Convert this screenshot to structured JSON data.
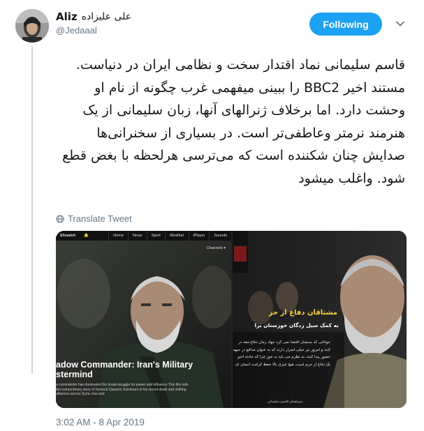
{
  "tweet": {
    "author_name": "Aliz",
    "author_name_fa": "علی علیزاده",
    "handle": "@Jedaaal",
    "follow_label": "Following",
    "text": "قاسم سلیمانی نماد اقتدار سخت و نظامی ایران در دنیاست. مستند اخیر BBC2 را ببینی میفهمی غرب چگونه از نام او وحشت دارد. اما برخلاف ژنرالهای آنها، زبان سلیمانی از یک هنرمند نرمتر وعاطفی‌تر است. در بسیاری از سخنرانی‌ها صدایش چنان شکننده است که می‌ترسی هرلحظه با بغض قطع شود. واغلب میشود",
    "translate_label": "Translate Tweet",
    "timestamp": "3:02 AM - 8 Apr 2019"
  },
  "media": {
    "left": {
      "nav_items": [
        "Home",
        "News",
        "Sport",
        "Weather",
        "iPlayer",
        "Sounds"
      ],
      "nav_brand": "Elizadeh",
      "channels_label": "Channels ▾",
      "title": "adow Commander: Iran's Military\nstermind",
      "description": "a commander has dominated the brutal struggle for power and influence This film tells the extraordinary story of General Qassem Suleimani of his secret deals and shifting alliances across Syria, Iraq and"
    },
    "right": {
      "poster_title": "مشتاقان دفاع از حر",
      "poster_subtitle": "به کمک سیل زدگان خوزستان برا",
      "poster_body": "جوانانی که سنشان اقتضا نمی کرد جهاد زمان دفاع مقد در کنند و امروز نیز خیلی اصرار دارند که به عنوان مدافع در جبهه حضور پیدا کنند، به نظرم می باید به خوز چرا که حادثه اخیر یک دفاع از حرم است، هیچ چیزی بالا حفظ کرامت انسان ای",
      "signature": "سرلشکر قاسم سلیمانی"
    }
  },
  "colors": {
    "follow_button": "#1da1f2",
    "text": "#14171a",
    "secondary": "#657786",
    "thread_line": "#ccd6dd"
  },
  "icons": {
    "caret": "chevron-down-icon",
    "translate": "globe-icon"
  }
}
